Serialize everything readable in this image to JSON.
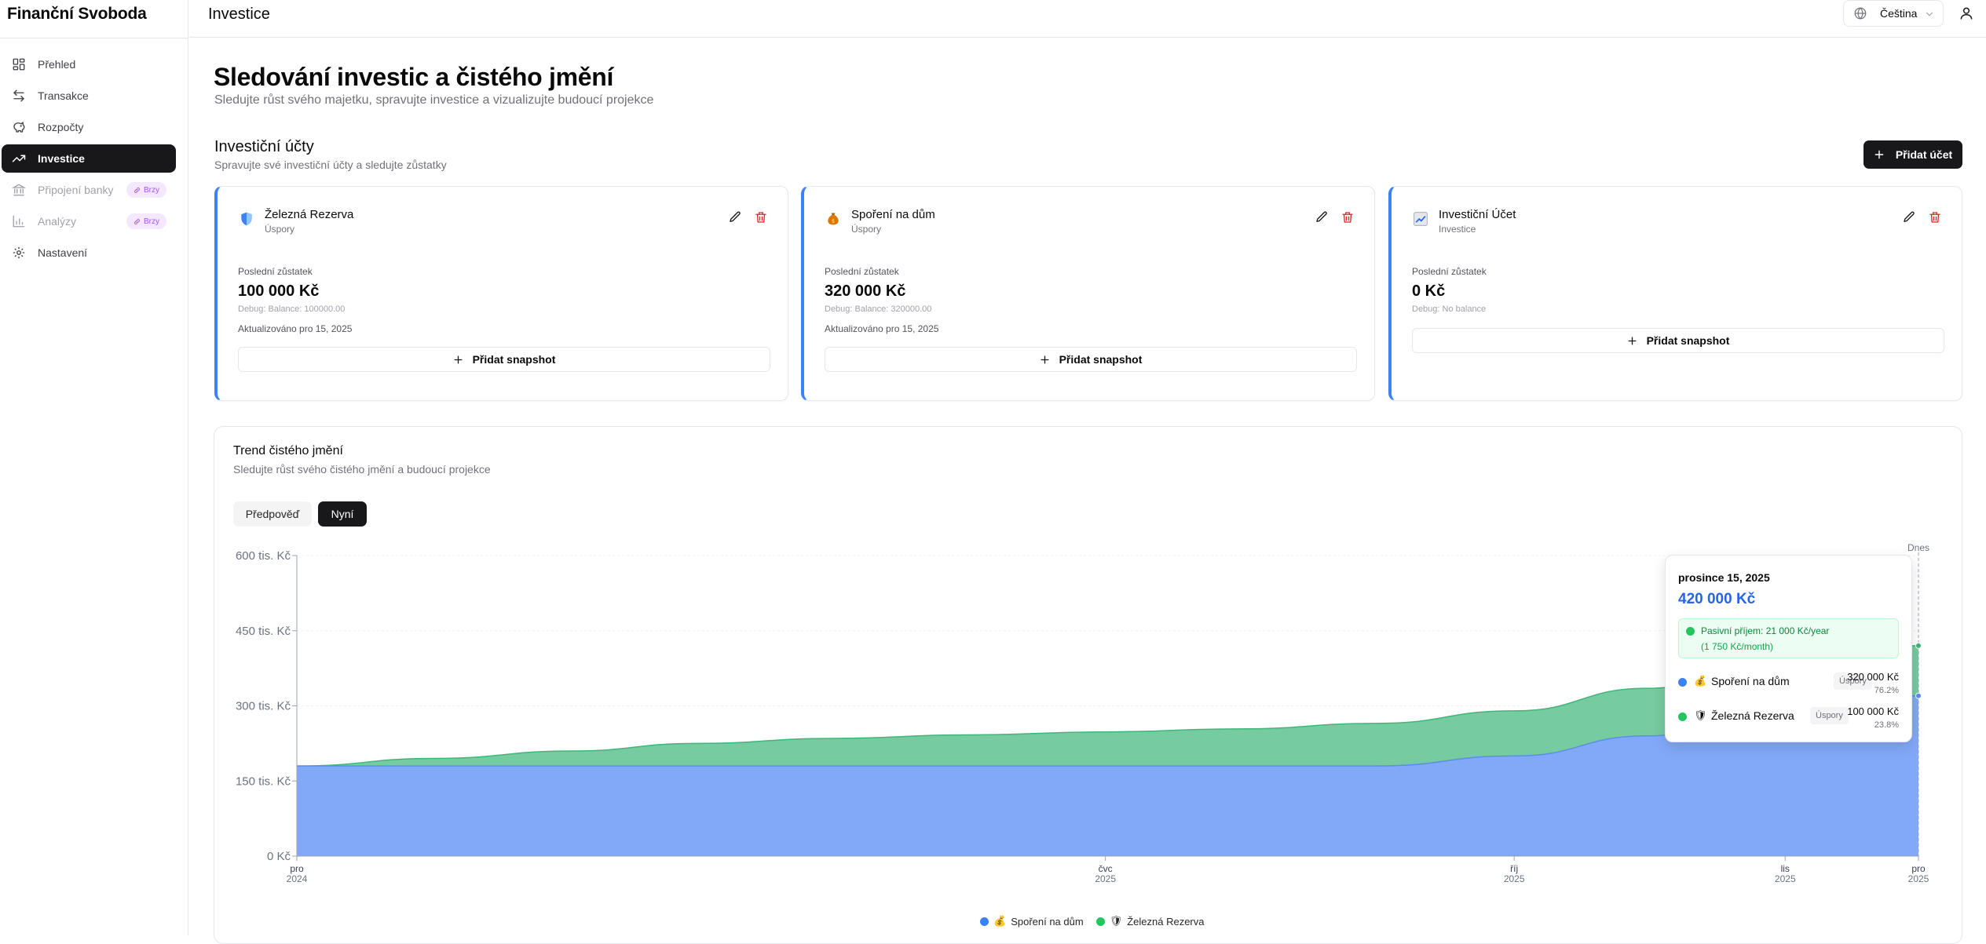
{
  "app": {
    "brand": "Finanční Svoboda",
    "page_heading": "Investice",
    "language": "Čeština"
  },
  "sidebar": {
    "items": [
      {
        "label": "Přehled",
        "icon": "layout-dashboard-icon",
        "state": "normal"
      },
      {
        "label": "Transakce",
        "icon": "arrow-left-right-icon",
        "state": "normal"
      },
      {
        "label": "Rozpočty",
        "icon": "piggy-bank-icon",
        "state": "normal"
      },
      {
        "label": "Investice",
        "icon": "trending-up-icon",
        "state": "active"
      },
      {
        "label": "Připojení banky",
        "icon": "landmark-icon",
        "state": "disabled",
        "badge": "Brzy"
      },
      {
        "label": "Analýzy",
        "icon": "bar-chart-icon",
        "state": "disabled",
        "badge": "Brzy"
      },
      {
        "label": "Nastavení",
        "icon": "gear-icon",
        "state": "normal"
      }
    ]
  },
  "header": {
    "title": "Sledování investic a čistého jmění",
    "subtitle": "Sledujte růst svého majetku, spravujte investice a vizualizujte budoucí projekce"
  },
  "accounts_section": {
    "title": "Investiční účty",
    "subtitle": "Spravujte své investiční účty a sledujte zůstatky",
    "add_label": "Přidat účet",
    "balance_label": "Poslední zůstatek",
    "snapshot_label": "Přidat snapshot",
    "accounts": [
      {
        "name": "Železná Rezerva",
        "type": "Úspory",
        "emoji": "🛡",
        "balance": "100 000 Kč",
        "debug": "Debug: Balance: 100000.00",
        "updated": "Aktualizováno pro 15, 2025"
      },
      {
        "name": "Spoření na dům",
        "type": "Úspory",
        "emoji": "💰",
        "balance": "320 000 Kč",
        "debug": "Debug: Balance: 320000.00",
        "updated": "Aktualizováno pro 15, 2025"
      },
      {
        "name": "Investiční Účet",
        "type": "Investice",
        "emoji": "📈",
        "balance": "0 Kč",
        "debug": "Debug: No balance",
        "updated": ""
      }
    ]
  },
  "trend": {
    "title": "Trend čistého jmění",
    "subtitle": "Sledujte růst svého čistého jmění a budoucí projekce",
    "tabs": [
      "Předpověď",
      "Nyní"
    ],
    "active_tab": "Nyní",
    "today_label": "Dnes"
  },
  "chart_data": {
    "type": "area",
    "stacked": true,
    "x": [
      "2024-12-15",
      "2025-01-15",
      "2025-02-15",
      "2025-03-15",
      "2025-04-15",
      "2025-05-15",
      "2025-06-15",
      "2025-07-15",
      "2025-08-15",
      "2025-09-15",
      "2025-10-15",
      "2025-11-15",
      "2025-12-15"
    ],
    "x_ticks": [
      {
        "month": "pro",
        "year": "2024"
      },
      {
        "month": "čvc",
        "year": "2025"
      },
      {
        "month": "říj",
        "year": "2025"
      },
      {
        "month": "lis",
        "year": "2025"
      },
      {
        "month": "pro",
        "year": "2025"
      }
    ],
    "x_tick_dates": [
      "2024-12-15",
      "2025-06-15",
      "2025-09-15",
      "2025-11-15",
      "2025-12-15"
    ],
    "y_ticks": [
      "0 Kč",
      "150 tis. Kč",
      "300 tis. Kč",
      "450 tis. Kč",
      "600 tis. Kč"
    ],
    "ylim": [
      0,
      600000
    ],
    "grid": true,
    "legend_position": "bottom",
    "series": [
      {
        "name": "Spoření na dům",
        "emoji": "💰",
        "color": "#5b8def",
        "fill": "#82a8f8",
        "values": [
          180000,
          180000,
          180000,
          180000,
          180000,
          180000,
          180000,
          180000,
          180000,
          200000,
          240000,
          300000,
          320000
        ]
      },
      {
        "name": "Železná Rezerva",
        "emoji": "🛡",
        "color": "#3fb67a",
        "fill": "#77cba0",
        "values": [
          0,
          15000,
          30000,
          45000,
          55000,
          62000,
          68000,
          74000,
          85000,
          90000,
          95000,
          100000,
          100000
        ]
      }
    ]
  },
  "tooltip": {
    "date": "prosince 15, 2025",
    "total": "420 000 Kč",
    "passive_prefix": "Pasivní příjem: ",
    "passive_value": "21 000 Kč/year",
    "passive_monthly": "(1 750 Kč/month)",
    "rows": [
      {
        "name": "Spoření na dům",
        "emoji": "💰",
        "tag": "Úspory",
        "value": "320 000 Kč",
        "pct": "76.2%",
        "color": "#3b82f6"
      },
      {
        "name": "Železná Rezerva",
        "emoji": "🛡",
        "tag": "Úspory",
        "value": "100 000 Kč",
        "pct": "23.8%",
        "color": "#22c55e"
      }
    ]
  },
  "colors": {
    "accent": "#18181b",
    "card_border": "#3b82f6",
    "danger": "#dc2626",
    "badge_bg": "#f3e8ff",
    "badge_text": "#a855f7"
  }
}
